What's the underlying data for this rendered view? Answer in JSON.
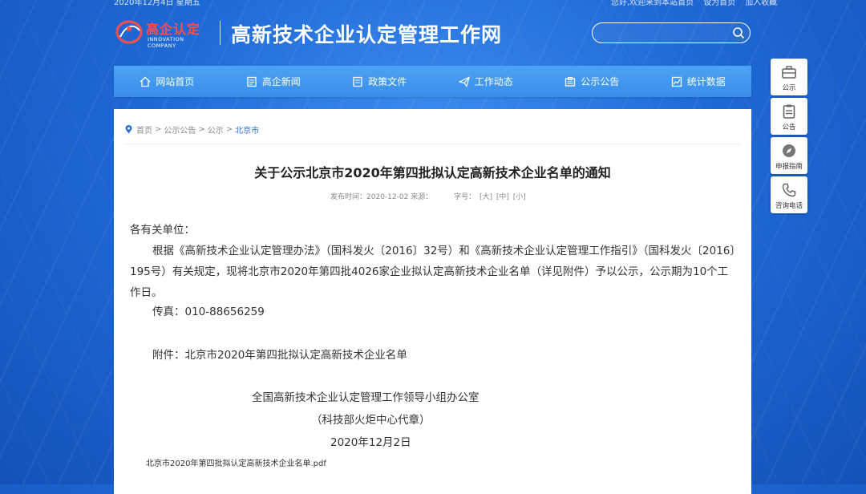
{
  "topbar": {
    "date": "2020年12月4日 星期五",
    "links": [
      "您好,欢迎来到本站首页",
      "设为首页",
      "加入收藏"
    ]
  },
  "header": {
    "logo_text": "高企认定",
    "logo_sub": "INNOVATION COMPANY",
    "site_title": "高新技术企业认定管理工作网",
    "search_placeholder": ""
  },
  "nav": {
    "items": [
      {
        "label": "网站首页",
        "icon": "home-icon"
      },
      {
        "label": "高企新闻",
        "icon": "document-icon"
      },
      {
        "label": "政策文件",
        "icon": "file-list-icon"
      },
      {
        "label": "工作动态",
        "icon": "send-icon"
      },
      {
        "label": "公示公告",
        "icon": "notice-icon"
      },
      {
        "label": "统计数据",
        "icon": "chart-icon"
      }
    ]
  },
  "breadcrumb": {
    "home": "首页",
    "sep": ">",
    "items": [
      "公示公告",
      "公示"
    ],
    "current": "北京市"
  },
  "article": {
    "title": "关于公示北京市2020年第四批拟认定高新技术企业名单的通知",
    "publish_label": "发布时间：",
    "publish_date": "2020-12-02",
    "source_label": "来源：",
    "source": "",
    "font_size_label": "字号：",
    "font_sizes": [
      "[大]",
      "[中]",
      "[小]"
    ],
    "salutation": "各有关单位：",
    "paragraph": "根据《高新技术企业认定管理办法》（国科发火〔2016〕32号）和《高新技术企业认定管理工作指引》（国科发火〔2016〕195号）有关规定，现将北京市2020年第四批4026家企业拟认定高新技术企业名单（详见附件）予以公示，公示期为10个工作日。",
    "fax": "传真：010-88656259",
    "attachment": "附件：北京市2020年第四批拟认定高新技术企业名单",
    "signature_org": "全国高新技术企业认定管理工作领导小组办公室",
    "signature_seal": "（科技部火炬中心代章）",
    "signature_date": "2020年12月2日",
    "pdf": "北京市2020年第四批拟认定高新技术企业名单.pdf"
  },
  "side_tools": [
    {
      "label": "公示",
      "icon": "briefcase-icon"
    },
    {
      "label": "公告",
      "icon": "clipboard-icon"
    },
    {
      "label": "申报指南",
      "icon": "compass-icon"
    },
    {
      "label": "咨询电话",
      "icon": "phone-icon"
    }
  ],
  "colors": {
    "background": "#1f6ad6",
    "nav": "#3a8ee9",
    "logo_red": "#ff4d4d",
    "link_blue": "#2a6fd0"
  }
}
